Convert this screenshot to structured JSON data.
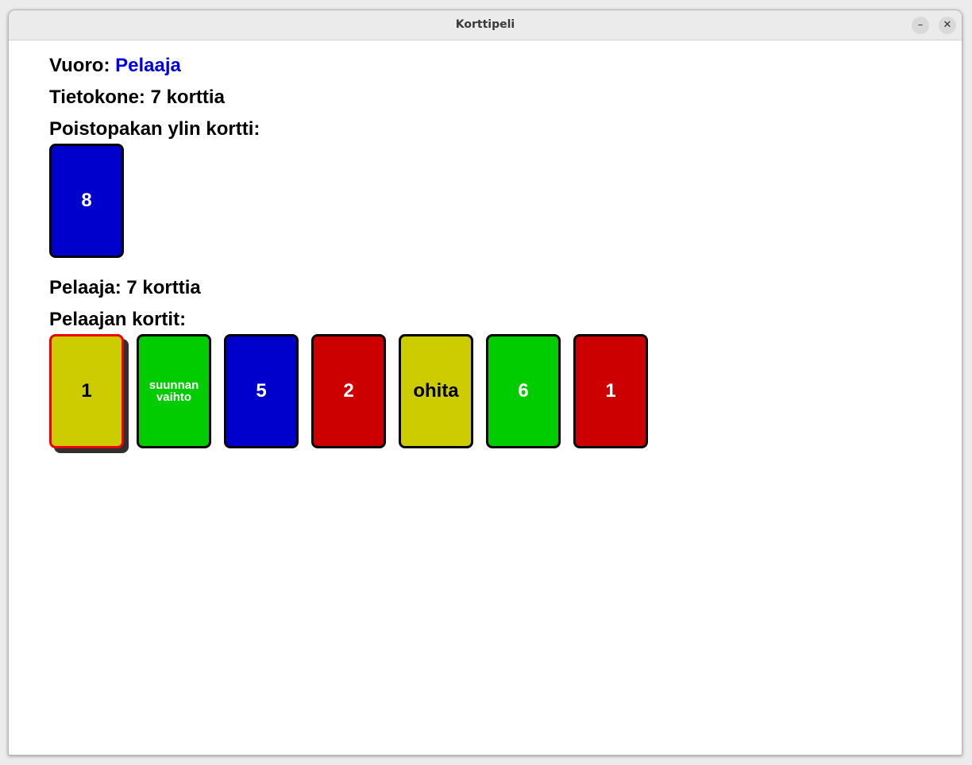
{
  "window": {
    "title": "Korttipeli",
    "minimize_label": "–",
    "close_label": "✕"
  },
  "status": {
    "turn_label": "Vuoro:",
    "turn_value": "Pelaaja",
    "computer_label": "Tietokone: 7 korttia",
    "discard_label": "Poistopakan ylin kortti:",
    "player_label": "Pelaaja: 7 korttia",
    "hand_label": "Pelaajan kortit:"
  },
  "discard_top": {
    "text": "8",
    "color": "blue"
  },
  "hand": [
    {
      "text": "1",
      "color": "yellow",
      "selected": true
    },
    {
      "text": "suunnan vaihto",
      "color": "green"
    },
    {
      "text": "5",
      "color": "blue"
    },
    {
      "text": "2",
      "color": "red"
    },
    {
      "text": "ohita",
      "color": "yellow"
    },
    {
      "text": "6",
      "color": "green"
    },
    {
      "text": "1",
      "color": "red"
    }
  ],
  "colors": {
    "blue": "#0000cc",
    "green": "#00cc00",
    "red": "#cc0000",
    "yellow": "#cccc00",
    "accent": "#0000e6",
    "selected_border": "#ee0000"
  }
}
